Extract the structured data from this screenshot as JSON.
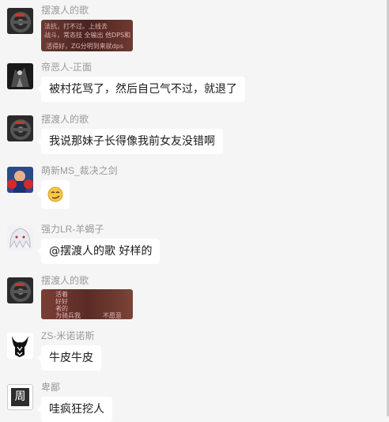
{
  "messages": [
    {
      "name": "摆渡人的歌",
      "type": "image",
      "image_text": [
        "战斗，常态技 全输出 他DPS和",
        "上线去",
        "法抗，打不过。",
        "活得好，ZG分明到来就dps"
      ]
    },
    {
      "name": "帝恶人-正面",
      "type": "text",
      "text": "被村花骂了，然后自己气不过，就退了"
    },
    {
      "name": "摆渡人的歌",
      "type": "text",
      "text": "我说那妹子长得像我前女友没错啊"
    },
    {
      "name": "萌新MS_裁决之剑",
      "type": "emoji",
      "emoji": "🙄"
    },
    {
      "name": "强力LR-羊蝎子",
      "type": "text",
      "text": "@摆渡人的歌 好样的"
    },
    {
      "name": "摆渡人的歌",
      "type": "image",
      "image_text": [
        "活着",
        "好好",
        "者的",
        "为骑兵我",
        "不愿意"
      ]
    },
    {
      "name": "ZS-米诺诺斯",
      "type": "text",
      "text": "牛皮牛皮"
    },
    {
      "name": "卑鄙",
      "type": "text",
      "text": "哇疯狂挖人"
    }
  ],
  "avatar_glyphs": {
    "bei_bi": "周"
  },
  "colors": {
    "background": "#f5f5f5",
    "bubble": "#ffffff",
    "name_text": "#9a9a9a"
  }
}
